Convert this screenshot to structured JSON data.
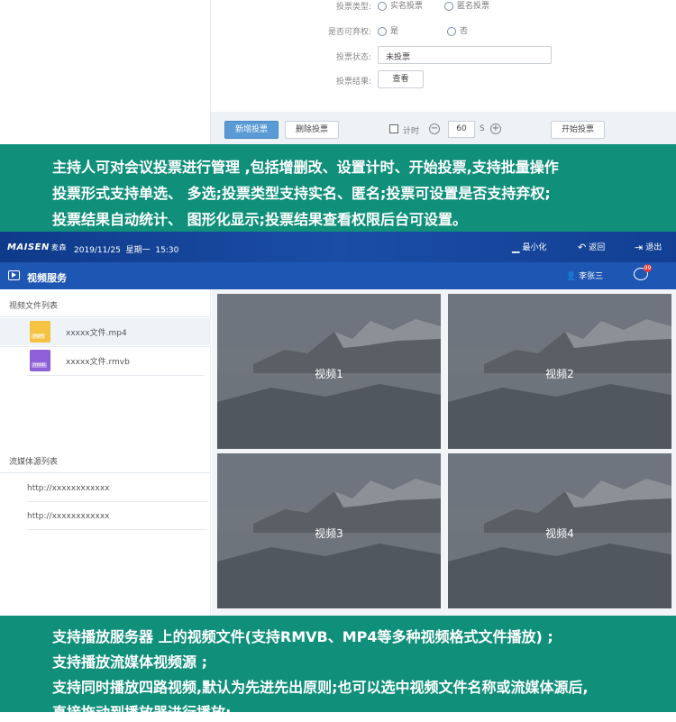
{
  "vote_form": {
    "type_label": "投票类型:",
    "type_options": [
      "实名投票",
      "匿名投票"
    ],
    "abstain_label": "是否可弃权:",
    "abstain_options": [
      "是",
      "否"
    ],
    "status_label": "投票状态:",
    "status_value": "未投票",
    "result_label": "投票结果:",
    "result_button": "查看",
    "toolbar": {
      "add_button": "新增投票",
      "delete_button": "删除投票",
      "timer_label": "计时",
      "timer_value": "60",
      "timer_unit": "S",
      "start_button": "开始投票"
    }
  },
  "banner_top": {
    "lines": [
      "主持人可对会议投票进行管理 ,包括增删改、设置计时、开始投票,支持批量操作",
      "投票形式支持单选、 多选;投票类型支持实名、匿名;投票可设置是否支持弃权;",
      "投票结果自动统计、 图形化显示;投票结果查看权限后台可设置。"
    ]
  },
  "app": {
    "brand": "MAISEN",
    "brand_cn": "麦森",
    "date": "2019/11/25",
    "weekday": "星期一",
    "time": "15:30",
    "actions": {
      "minimize": "最小化",
      "back": "返回",
      "exit": "退出"
    },
    "module_title": "视频服务",
    "user_name": "李张三",
    "message_badge": "99",
    "sidebar": {
      "file_list_title": "视频文件列表",
      "files": [
        {
          "name": "xxxxx文件.mp4",
          "tag": "mp4",
          "color": "#f5c242"
        },
        {
          "name": "xxxxx文件.rmvb",
          "tag": "rmvb",
          "color": "#8e5fd6"
        }
      ],
      "stream_list_title": "流媒体源列表",
      "streams": [
        "http://xxxxxxxxxxxx",
        "http://xxxxxxxxxxxx"
      ]
    },
    "videos": [
      "视频1",
      "视频2",
      "视频3",
      "视频4"
    ]
  },
  "banner_bottom": {
    "lines": [
      "支持播放服务器 上的视频文件(支持RMVB、MP4等多种视频格式文件播放) ;",
      "支持播放流媒体视频源 ;",
      "支持同时播放四路视频,默认为先进先出原则;也可以选中视频文件名称或流媒体源后,",
      "直接拖动到播放器进行播放;"
    ]
  }
}
